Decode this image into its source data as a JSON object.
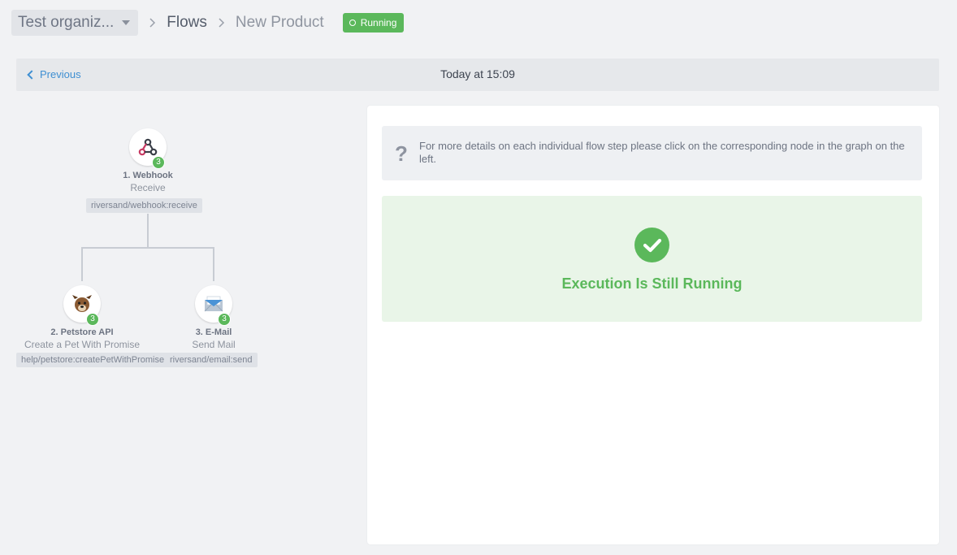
{
  "header": {
    "org_name": "Test organiz...",
    "breadcrumb_flows": "Flows",
    "breadcrumb_flow_name": "New Product",
    "status_badge": "Running"
  },
  "navbar": {
    "previous_label": "Previous",
    "date_label": "Today at 15:09"
  },
  "graph": {
    "nodes": [
      {
        "title": "1. Webhook",
        "subtitle": "Receive",
        "path": "riversand/webhook:receive",
        "count": "3",
        "icon": "webhook-icon"
      },
      {
        "title": "2. Petstore API",
        "subtitle": "Create a Pet With Promise",
        "path": "help/petstore:createPetWithPromise",
        "count": "3",
        "icon": "dog-icon"
      },
      {
        "title": "3. E-Mail",
        "subtitle": "Send Mail",
        "path": "riversand/email:send",
        "count": "3",
        "icon": "email-icon"
      }
    ]
  },
  "panel": {
    "info_text": "For more details on each individual flow step please click on the corresponding node in the graph on the left.",
    "info_icon": "question-icon",
    "success_text": "Execution Is Still Running",
    "success_icon": "check-icon"
  },
  "colors": {
    "accent_green": "#5bb85b",
    "link_blue": "#3f8fd2",
    "background": "#f1f2f4"
  }
}
